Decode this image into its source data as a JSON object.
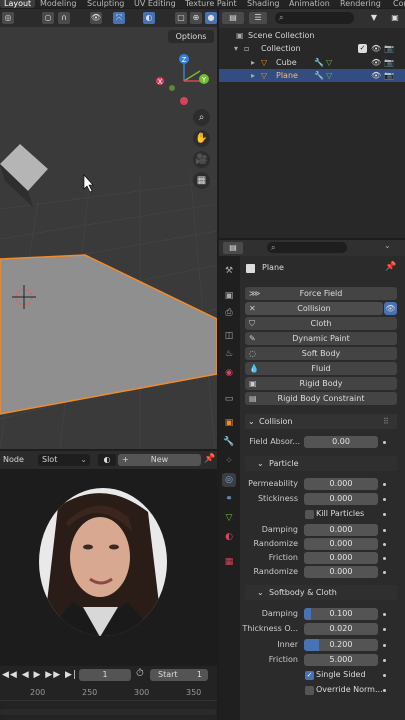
{
  "topbar": {
    "tabs": [
      "Layout",
      "Modeling",
      "Sculpting",
      "UV Editing",
      "Texture Paint",
      "Shading",
      "Animation",
      "Rendering",
      "Cor"
    ],
    "active_index": 0
  },
  "viewport": {
    "options_label": "Options",
    "gizmo": {
      "z": "Z",
      "y": "Y",
      "x": "X"
    }
  },
  "outliner": {
    "scene_collection": "Scene Collection",
    "collection": "Collection",
    "items": [
      {
        "label": "Cube",
        "selected": false
      },
      {
        "label": "Plane",
        "selected": true
      }
    ]
  },
  "properties": {
    "object_name": "Plane",
    "physics_buttons": [
      "Force Field",
      "Collision",
      "Cloth",
      "Dynamic Paint",
      "Soft Body",
      "Fluid",
      "Rigid Body",
      "Rigid Body Constraint"
    ],
    "collision_panel": "Collision",
    "field_absorption": {
      "label": "Field Absor...",
      "value": "0.00"
    },
    "particle_panel": "Particle",
    "permeability": {
      "label": "Permeability",
      "value": "0.000"
    },
    "stickiness": {
      "label": "Stickiness",
      "value": "0.000"
    },
    "kill_particles": "Kill Particles",
    "damping": {
      "label": "Damping",
      "value": "0.000"
    },
    "damping_randomize": {
      "label": "Randomize",
      "value": "0.000"
    },
    "friction": {
      "label": "Friction",
      "value": "0.000"
    },
    "friction_randomize": {
      "label": "Randomize",
      "value": "0.000"
    },
    "softbody_panel": "Softbody & Cloth",
    "sb_damping": {
      "label": "Damping",
      "value": "0.100",
      "fill": 0.1
    },
    "sb_thickness": {
      "label": "Thickness O...",
      "value": "0.020"
    },
    "sb_inner": {
      "label": "Inner",
      "value": "0.200",
      "fill": 0.2
    },
    "sb_friction": {
      "label": "Friction",
      "value": "5.000"
    },
    "single_sided": "Single Sided",
    "override_normals": "Override Norm..."
  },
  "node_editor": {
    "node_label": "Node",
    "slot_label": "Slot",
    "new_label": "New"
  },
  "timeline": {
    "current_frame": "1",
    "start_label": "Start",
    "start_value": "1",
    "ticks": [
      "200",
      "250",
      "300",
      "350"
    ]
  },
  "colors": {
    "accent": "#4772b3",
    "selection": "#334d80",
    "object_orange": "#f08c2a"
  }
}
